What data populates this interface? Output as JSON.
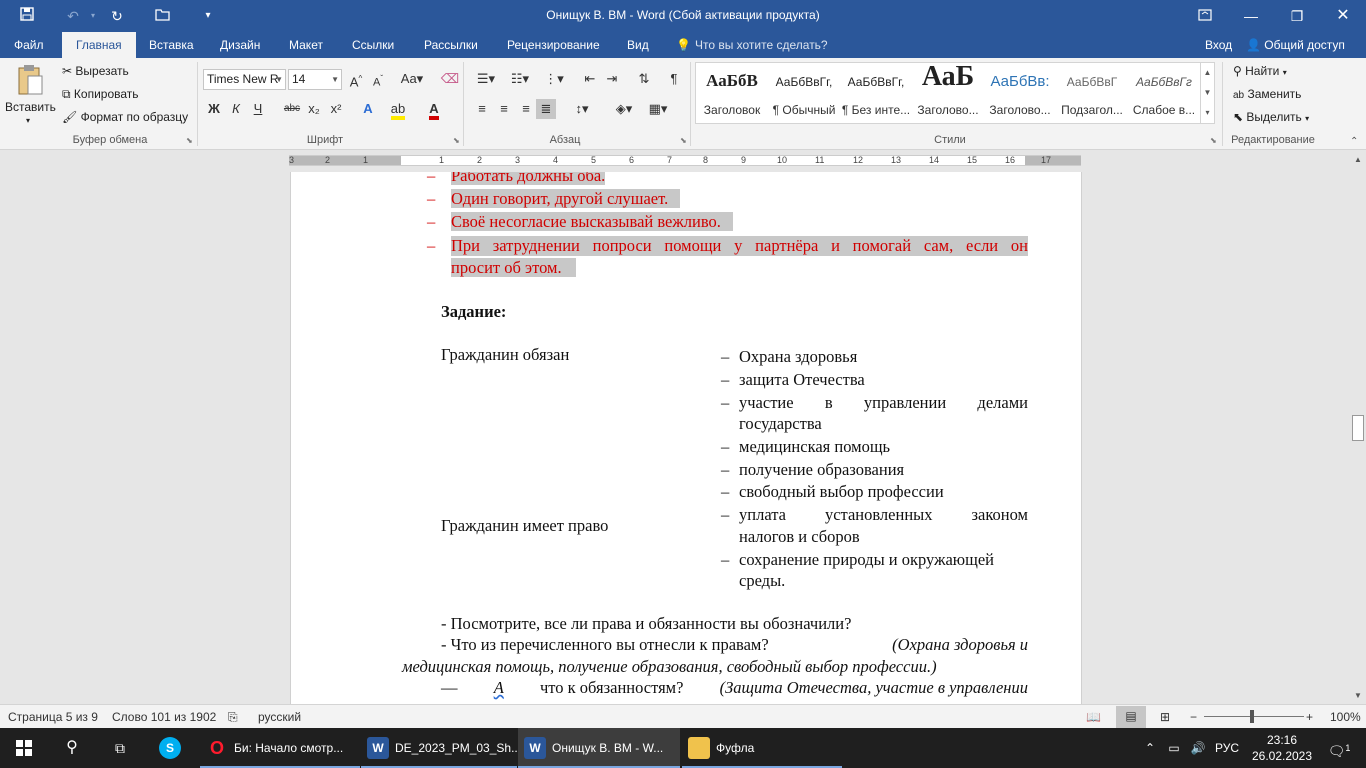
{
  "window": {
    "title": "Онищук В. ВМ - Word (Сбой активации продукта)"
  },
  "tabs": {
    "file": "Файл",
    "home": "Главная",
    "insert": "Вставка",
    "design": "Дизайн",
    "layout": "Макет",
    "references": "Ссылки",
    "mailings": "Рассылки",
    "review": "Рецензирование",
    "view": "Вид",
    "tell_me": "Что вы хотите сделать?",
    "sign_in": "Вход",
    "share": "Общий доступ"
  },
  "ribbon": {
    "clipboard": {
      "paste": "Вставить",
      "cut": "Вырезать",
      "copy": "Копировать",
      "format_painter": "Формат по образцу",
      "label": "Буфер обмена"
    },
    "font": {
      "name": "Times New R",
      "size": "14",
      "label": "Шрифт",
      "bold": "Ж",
      "italic": "К",
      "underline": "Ч",
      "strike": "abc",
      "subscript": "x₂",
      "superscript": "x²"
    },
    "paragraph": {
      "label": "Абзац"
    },
    "styles": {
      "label": "Стили",
      "items": [
        {
          "preview": "АаБбВ",
          "name": "Заголовок"
        },
        {
          "preview": "АаБбВвГг,",
          "name": "¶ Обычный"
        },
        {
          "preview": "АаБбВвГг,",
          "name": "¶ Без инте..."
        },
        {
          "preview": "АаБ",
          "name": "Заголово..."
        },
        {
          "preview": "АаБбВв:",
          "name": "Заголово..."
        },
        {
          "preview": "АаБбВвГ",
          "name": "Подзагол..."
        },
        {
          "preview": "АаБбВвГг",
          "name": "Слабое в..."
        }
      ]
    },
    "editing": {
      "label": "Редактирование",
      "find": "Найти",
      "replace": "Заменить",
      "select": "Выделить"
    }
  },
  "ruler": {
    "numbers": [
      "3",
      "2",
      "1",
      "1",
      "2",
      "3",
      "4",
      "5",
      "6",
      "7",
      "8",
      "9",
      "10",
      "11",
      "12",
      "13",
      "14",
      "15",
      "16",
      "17"
    ]
  },
  "document": {
    "rules": [
      "Работать должны оба.",
      "Один говорит, другой слушает.",
      "Своё несогласие высказывай вежливо.",
      "При затруднении попроси помощи у партнёра и помогай сам, если он",
      "просит об этом."
    ],
    "task_heading": "Задание:",
    "left_obliged": "Гражданин обязан",
    "left_right": "Гражданин имеет право",
    "right_items": [
      "Охрана здоровья",
      "защита Отечества",
      "участие в управлении делами",
      "государства",
      "медицинская помощь",
      "получение образования",
      "свободный выбор профессии",
      "уплата установленных законом",
      "налогов и сборов",
      "сохранение природы и окружающей",
      "среды."
    ],
    "q1": "- Посмотрите, все ли права и обязанности вы обозначили?",
    "q2_plain": "- Что из перечисленного вы отнесли к правам?",
    "q2_italic": "(Охрана здоровья и",
    "q2_cont": "медицинская помощь, получение образования, свободный выбор профессии.)",
    "q3_dash": "—",
    "q3_a": "А",
    "q3_plain": "что к обязанностям?",
    "q3_italic": "(Защита Отечества, участие в управлении"
  },
  "statusbar": {
    "page": "Страница 5 из 9",
    "words": "Слово 101 из 1902",
    "language": "русский",
    "zoom": "100%"
  },
  "taskbar": {
    "items": [
      {
        "label": "Би: Начало смотр...",
        "icon": "opera-icon"
      },
      {
        "label": "DE_2023_PM_03_Sh...",
        "icon": "word-icon"
      },
      {
        "label": "Онищук В. ВМ - W...",
        "icon": "word-icon"
      },
      {
        "label": "Фуфла",
        "icon": "folder-icon"
      }
    ],
    "language": "РУС",
    "time": "23:16",
    "date": "26.02.2023",
    "notifications": "1"
  },
  "colors": {
    "accent": "#2b579a",
    "highlight_red": "#d00000"
  }
}
